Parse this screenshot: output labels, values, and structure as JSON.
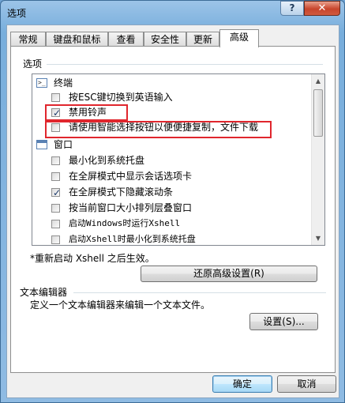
{
  "window": {
    "title": "选项",
    "help_glyph": "?",
    "close_glyph": "✕"
  },
  "tabs": [
    {
      "label": "常规"
    },
    {
      "label": "键盘和鼠标"
    },
    {
      "label": "查看"
    },
    {
      "label": "安全性"
    },
    {
      "label": "更新"
    },
    {
      "label": "高级",
      "active": true
    }
  ],
  "options_group": {
    "label": "选项",
    "tree": {
      "terminal_node": {
        "label": "终端",
        "icon": "terminal-icon"
      },
      "terminal_items": [
        {
          "label": "按ESC键切换到英语输入",
          "checked": false
        },
        {
          "label": "禁用铃声",
          "checked": true
        },
        {
          "label": "请使用智能选择按钮以便便捷复制，文件下载",
          "checked": false
        }
      ],
      "window_node": {
        "label": "窗口",
        "icon": "window-icon"
      },
      "window_items": [
        {
          "label": "最小化到系统托盘",
          "checked": false
        },
        {
          "label": "在全屏模式中显示会话选项卡",
          "checked": false
        },
        {
          "label": "在全屏模式下隐藏滚动条",
          "checked": true
        },
        {
          "label": "按当前窗口大小排列层叠窗口",
          "checked": false
        },
        {
          "label": "启动Windows时运行Xshell",
          "checked": false
        },
        {
          "label": "启动Xshell时最小化到系统托盘",
          "checked": false
        }
      ]
    },
    "restart_note": "*重新启动 Xshell 之后生效。",
    "restore_button": "还原高级设置(R)"
  },
  "text_editor_group": {
    "label": "文本编辑器",
    "description": "定义一个文本编辑器来编辑一个文本文件。",
    "settings_button": "设置(S)..."
  },
  "footer": {
    "ok_button": "确定",
    "cancel_button": "取消"
  },
  "colors": {
    "highlight_box": "#e0262d",
    "accent": "#3c7fb1"
  }
}
